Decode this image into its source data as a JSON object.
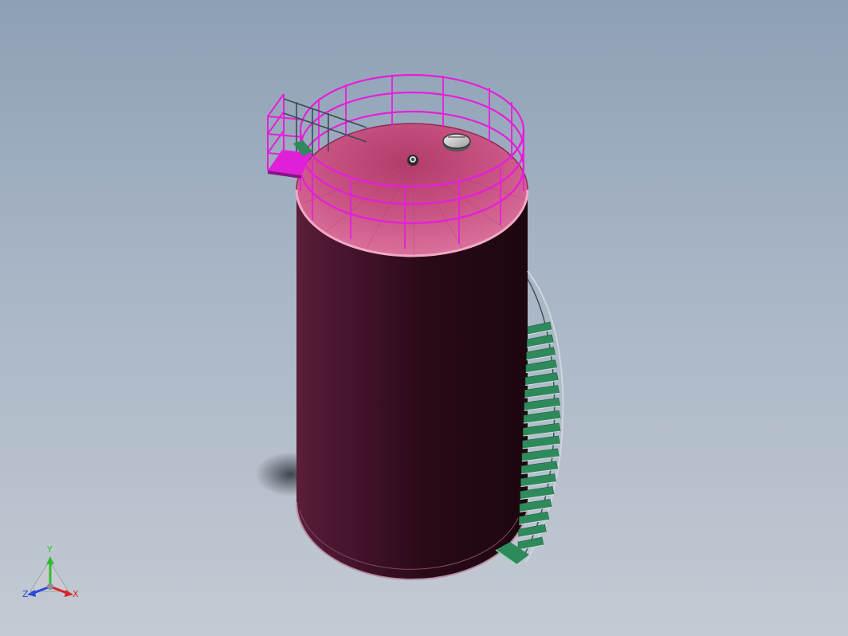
{
  "triad": {
    "x_label": "X",
    "y_label": "Y",
    "z_label": "Z",
    "colors": {
      "x": "#d8262b",
      "y": "#2fbd2f",
      "z": "#2a49d8"
    }
  },
  "model": {
    "shell_color": "#3c0f22",
    "roof_color": "#c8507e",
    "railing_color": "#e51fd8",
    "stair_color": "#2e8a5a",
    "stair_steps": 18
  }
}
